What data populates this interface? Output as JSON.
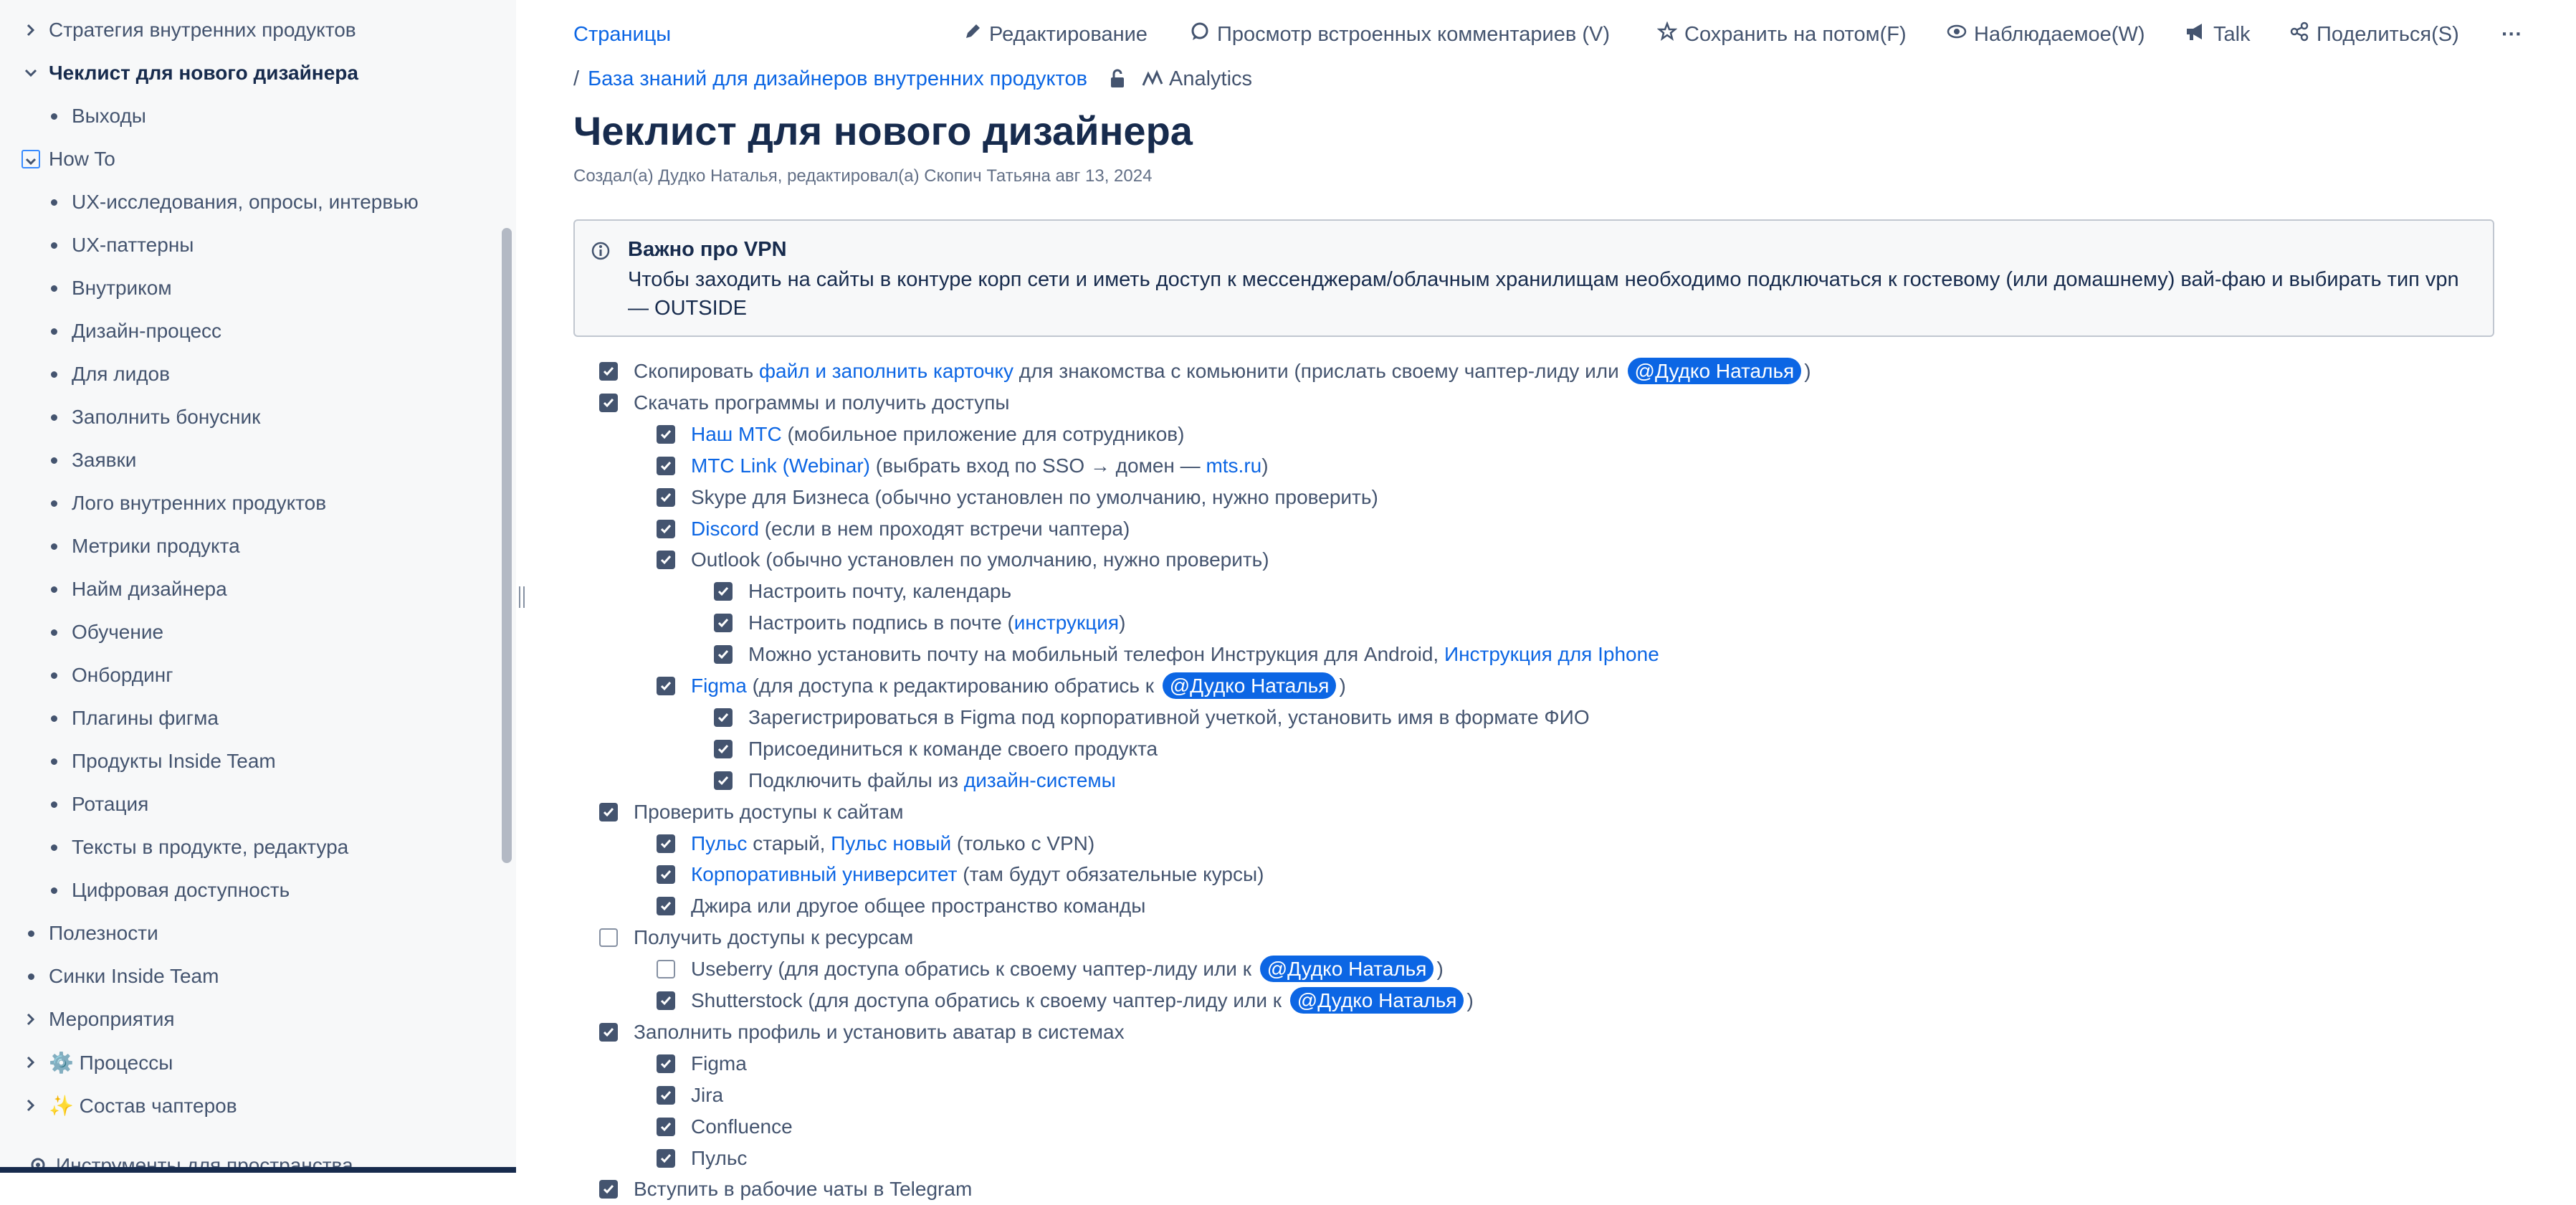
{
  "sidebar": {
    "items": [
      {
        "label": "Стратегия внутренних продуктов",
        "marker": "chevron-right"
      },
      {
        "label": "Чеклист для нового дизайнера",
        "marker": "chevron-down"
      },
      {
        "label": "Выходы",
        "marker": "bullet"
      },
      {
        "label": "How To",
        "marker": "chevron-down-focused"
      },
      {
        "label": "UX-исследования, опросы, интервью",
        "marker": "bullet"
      },
      {
        "label": "UX-паттерны",
        "marker": "bullet"
      },
      {
        "label": "Внутриком",
        "marker": "bullet"
      },
      {
        "label": "Дизайн-процесс",
        "marker": "bullet"
      },
      {
        "label": "Для лидов",
        "marker": "bullet"
      },
      {
        "label": "Заполнить бонусник",
        "marker": "bullet"
      },
      {
        "label": "Заявки",
        "marker": "bullet"
      },
      {
        "label": "Лого внутренних продуктов",
        "marker": "bullet"
      },
      {
        "label": "Метрики продукта",
        "marker": "bullet"
      },
      {
        "label": "Найм дизайнера",
        "marker": "bullet"
      },
      {
        "label": "Обучение",
        "marker": "bullet"
      },
      {
        "label": "Онбординг",
        "marker": "bullet"
      },
      {
        "label": "Плагины фигма",
        "marker": "bullet"
      },
      {
        "label": "Продукты Inside Team",
        "marker": "bullet"
      },
      {
        "label": "Ротация",
        "marker": "bullet"
      },
      {
        "label": "Тексты в продукте, редактура",
        "marker": "bullet"
      },
      {
        "label": "Цифровая доступность",
        "marker": "bullet"
      },
      {
        "label": "Полезности",
        "marker": "bullet"
      },
      {
        "label": "Синки Inside Team",
        "marker": "bullet"
      },
      {
        "label": "Мероприятия",
        "marker": "chevron-right"
      },
      {
        "label": "⚙️ Процессы",
        "marker": "chevron-right"
      },
      {
        "label": "✨ Состав чаптеров",
        "marker": "chevron-right"
      }
    ],
    "bottom_label": "Инструменты для пространства"
  },
  "topbar": {
    "pages": "Страницы",
    "edit": "Редактирование",
    "comments": "Просмотр встроенных комментариев (V)",
    "save_later": "Сохранить на потом(F)",
    "watch": "Наблюдаемое(W)",
    "talk": "Talk",
    "share": "Поделиться(S)",
    "more": "···"
  },
  "breadcrumb": {
    "separator": "/",
    "space": "База знаний для дизайнеров внутренних продуктов",
    "analytics": "Analytics"
  },
  "page": {
    "title": "Чеклист для нового дизайнера",
    "byline": "Создал(а) Дудко Наталья, редактировал(а) Скопич Татьяна авг 13, 2024"
  },
  "info_panel": {
    "title": "Важно про VPN",
    "text": "Чтобы заходить на сайты в контуре корп сети и иметь доступ к мессенджерам/облачным хранилищам необходимо подключаться к гостевому (или домашнему) вай-фаю и выбирать тип vpn — OUTSIDE"
  },
  "tasks": [
    {
      "checked": true,
      "level": 0,
      "parts": [
        [
          "t",
          "Скопировать "
        ],
        [
          "a",
          "файл и заполнить карточку"
        ],
        [
          "t",
          " для знакомства с комьюнити (прислать своему чаптер-лиду или "
        ],
        [
          "m",
          "@Дудко Наталья"
        ],
        [
          "t",
          ")"
        ]
      ]
    },
    {
      "checked": true,
      "level": 0,
      "parts": [
        [
          "t",
          "Скачать программы и получить доступы"
        ]
      ]
    },
    {
      "checked": true,
      "level": 1,
      "parts": [
        [
          "a",
          "Наш МТС"
        ],
        [
          "t",
          " (мобильное приложение для сотрудников)"
        ]
      ]
    },
    {
      "checked": true,
      "level": 1,
      "parts": [
        [
          "a",
          "МТС Link (Webinar)"
        ],
        [
          "t",
          " (выбрать вход по SSO → домен — "
        ],
        [
          "a",
          "mts.ru"
        ],
        [
          "t",
          ")"
        ]
      ]
    },
    {
      "checked": true,
      "level": 1,
      "parts": [
        [
          "t",
          "Skype для Бизнеса (обычно установлен по умолчанию, нужно проверить)"
        ]
      ]
    },
    {
      "checked": true,
      "level": 1,
      "parts": [
        [
          "a",
          "Discord"
        ],
        [
          "t",
          " (если в нем проходят встречи чаптера)"
        ]
      ]
    },
    {
      "checked": true,
      "level": 1,
      "parts": [
        [
          "t",
          "Outlook (обычно установлен по умолчанию, нужно проверить)"
        ]
      ]
    },
    {
      "checked": true,
      "level": 2,
      "parts": [
        [
          "t",
          "Настроить почту, календарь"
        ]
      ]
    },
    {
      "checked": true,
      "level": 2,
      "parts": [
        [
          "t",
          "Настроить подпись в почте ("
        ],
        [
          "a",
          "инструкция"
        ],
        [
          "t",
          ")"
        ]
      ]
    },
    {
      "checked": true,
      "level": 2,
      "parts": [
        [
          "t",
          "Можно установить почту на мобильный телефон Инструкция для Android, "
        ],
        [
          "a",
          "Инструкция для Iphone"
        ]
      ]
    },
    {
      "checked": true,
      "level": 1,
      "parts": [
        [
          "a",
          "Figma"
        ],
        [
          "t",
          " (для доступа к редактированию обратись к "
        ],
        [
          "m",
          "@Дудко Наталья"
        ],
        [
          "t",
          ")"
        ]
      ]
    },
    {
      "checked": true,
      "level": 2,
      "parts": [
        [
          "t",
          "Зарегистрироваться в Figma под корпоративной учеткой, установить имя в формате ФИО"
        ]
      ]
    },
    {
      "checked": true,
      "level": 2,
      "parts": [
        [
          "t",
          "Присоединиться к команде своего продукта"
        ]
      ]
    },
    {
      "checked": true,
      "level": 2,
      "parts": [
        [
          "t",
          "Подключить файлы из "
        ],
        [
          "a",
          "дизайн-системы"
        ]
      ]
    },
    {
      "checked": true,
      "level": 0,
      "parts": [
        [
          "t",
          "Проверить доступы к сайтам"
        ]
      ]
    },
    {
      "checked": true,
      "level": 1,
      "parts": [
        [
          "a",
          "Пульс"
        ],
        [
          "t",
          " старый, "
        ],
        [
          "a",
          "Пульс новый"
        ],
        [
          "t",
          " (только с VPN)"
        ]
      ]
    },
    {
      "checked": true,
      "level": 1,
      "parts": [
        [
          "a",
          "Корпоративный университет"
        ],
        [
          "t",
          " (там будут обязательные курсы)"
        ]
      ]
    },
    {
      "checked": true,
      "level": 1,
      "parts": [
        [
          "t",
          "Джира или другое общее пространство команды"
        ]
      ]
    },
    {
      "checked": false,
      "level": 0,
      "parts": [
        [
          "t",
          "Получить доступы к ресурсам"
        ]
      ]
    },
    {
      "checked": false,
      "level": 1,
      "parts": [
        [
          "t",
          "Useberry (для доступа обратись к своему чаптер-лиду или к "
        ],
        [
          "m",
          "@Дудко Наталья"
        ],
        [
          "t",
          ")"
        ]
      ]
    },
    {
      "checked": true,
      "level": 1,
      "parts": [
        [
          "t",
          "Shutterstock (для доступа обратись к своему чаптер-лиду или к "
        ],
        [
          "m",
          "@Дудко Наталья"
        ],
        [
          "t",
          ")"
        ]
      ]
    },
    {
      "checked": true,
      "level": 0,
      "parts": [
        [
          "t",
          "Заполнить профиль и установить аватар в системах"
        ]
      ]
    },
    {
      "checked": true,
      "level": 1,
      "parts": [
        [
          "t",
          "Figma"
        ]
      ]
    },
    {
      "checked": true,
      "level": 1,
      "parts": [
        [
          "t",
          "Jira"
        ]
      ]
    },
    {
      "checked": true,
      "level": 1,
      "parts": [
        [
          "t",
          "Confluence"
        ]
      ]
    },
    {
      "checked": true,
      "level": 1,
      "parts": [
        [
          "t",
          "Пульс"
        ]
      ]
    },
    {
      "checked": true,
      "level": 0,
      "parts": [
        [
          "t",
          "Вступить в рабочие чаты в Telegram"
        ]
      ]
    }
  ]
}
